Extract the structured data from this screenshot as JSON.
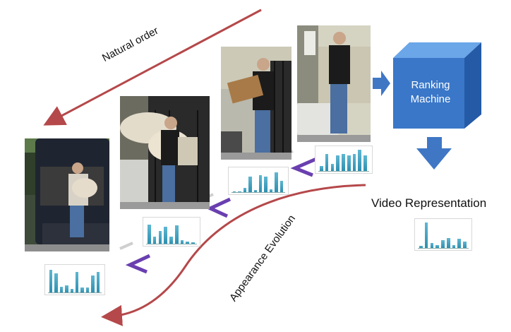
{
  "labels": {
    "natural_order": "Natural order",
    "appearance_evolution": "Appearance Evolution",
    "video_representation": "Video Representation",
    "ranking_machine_line1": "Ranking",
    "ranking_machine_line2": "Machine"
  },
  "colors": {
    "order_arrow": "#b5484a",
    "chevron": "#6a3fb0",
    "machine_front": "#3a77c8",
    "machine_top": "#6aa6e8",
    "machine_side": "#255aa6",
    "flow_arrow": "#3f77c5",
    "bar": "#2f93b5"
  },
  "frames": [
    {
      "name": "frame-car-trunk",
      "description": "woman loading bag into car trunk"
    },
    {
      "name": "frame-carrying-fur",
      "description": "woman carrying fur rug"
    },
    {
      "name": "frame-carrying-box",
      "description": "woman carrying cardboard box"
    },
    {
      "name": "frame-walking",
      "description": "woman walking on sidewalk"
    }
  ],
  "histograms": {
    "frame1": [
      0.95,
      0.8,
      0.25,
      0.3,
      0.15,
      0.85,
      0.2,
      0.2,
      0.7,
      0.85
    ],
    "frame2": [
      0.85,
      0.3,
      0.55,
      0.75,
      0.3,
      0.8,
      0.15,
      0.1,
      0.05
    ],
    "frame3": [
      0.05,
      0.05,
      0.2,
      0.75,
      0.1,
      0.8,
      0.75,
      0.15,
      0.95,
      0.55
    ],
    "frame4": [
      0.25,
      0.8,
      0.35,
      0.75,
      0.8,
      0.75,
      0.8,
      1.0,
      0.75
    ],
    "video": [
      0.08,
      1.0,
      0.2,
      0.1,
      0.3,
      0.4,
      0.1,
      0.35,
      0.25
    ]
  }
}
